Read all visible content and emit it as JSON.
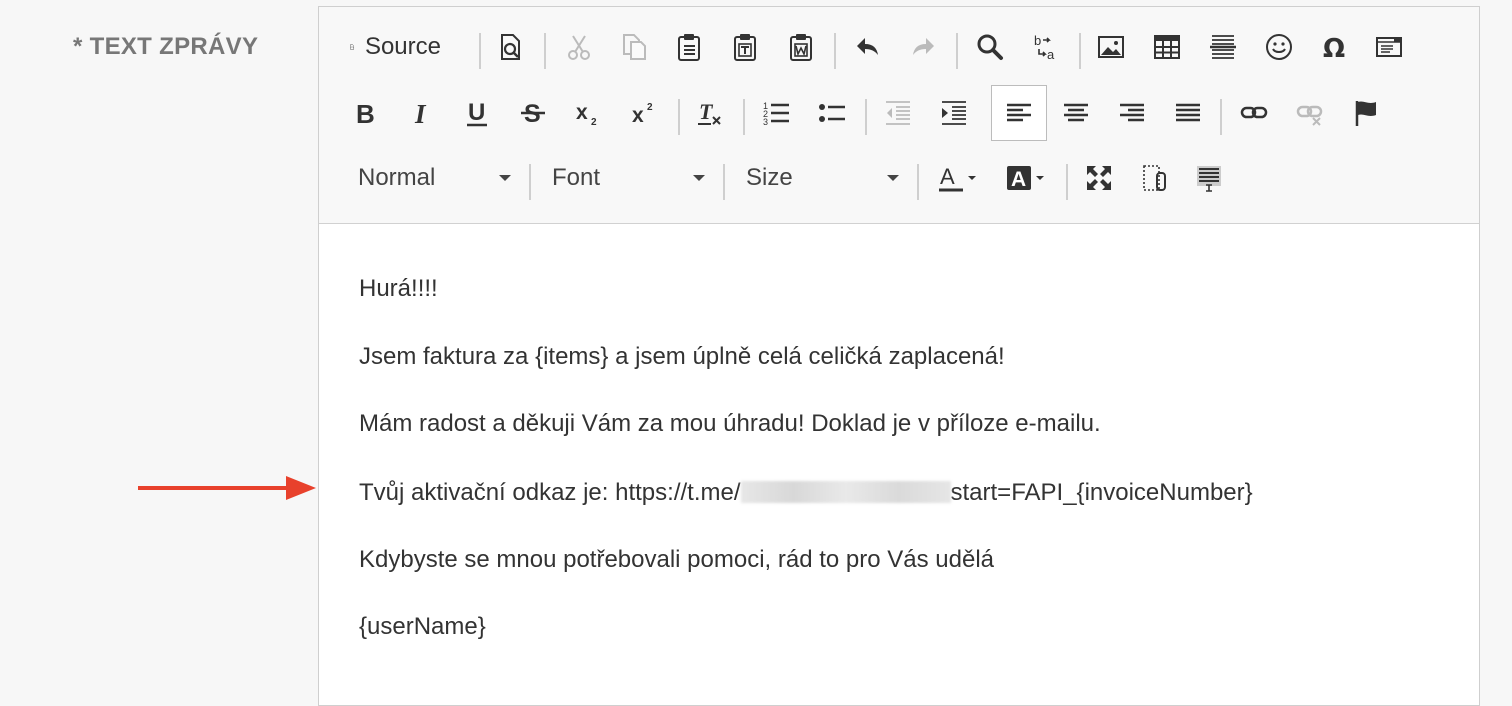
{
  "field": {
    "label": "* TEXT ZPRÁVY"
  },
  "toolbar": {
    "source_label": "Source",
    "format_combo": "Normal",
    "font_combo": "Font",
    "size_combo": "Size"
  },
  "content": {
    "p1": "Hurá!!!!",
    "p2": "Jsem faktura za {items} a jsem úplně celá celičká zaplacená!",
    "p3": "Mám radost a děkuji Vám za mou úhradu! Doklad je v příloze e-mailu.",
    "p4_prefix": "Tvůj aktivační odkaz je: https://t.me/",
    "p4_suffix": "start=FAPI_{invoiceNumber}",
    "p5": "Kdybyste se mnou potřebovali pomoci, rád to pro Vás udělá",
    "p6": "{userName}"
  },
  "colors": {
    "arrow": "#e8412c",
    "toolbar_bg": "#f8f8f8",
    "label": "#777777"
  }
}
